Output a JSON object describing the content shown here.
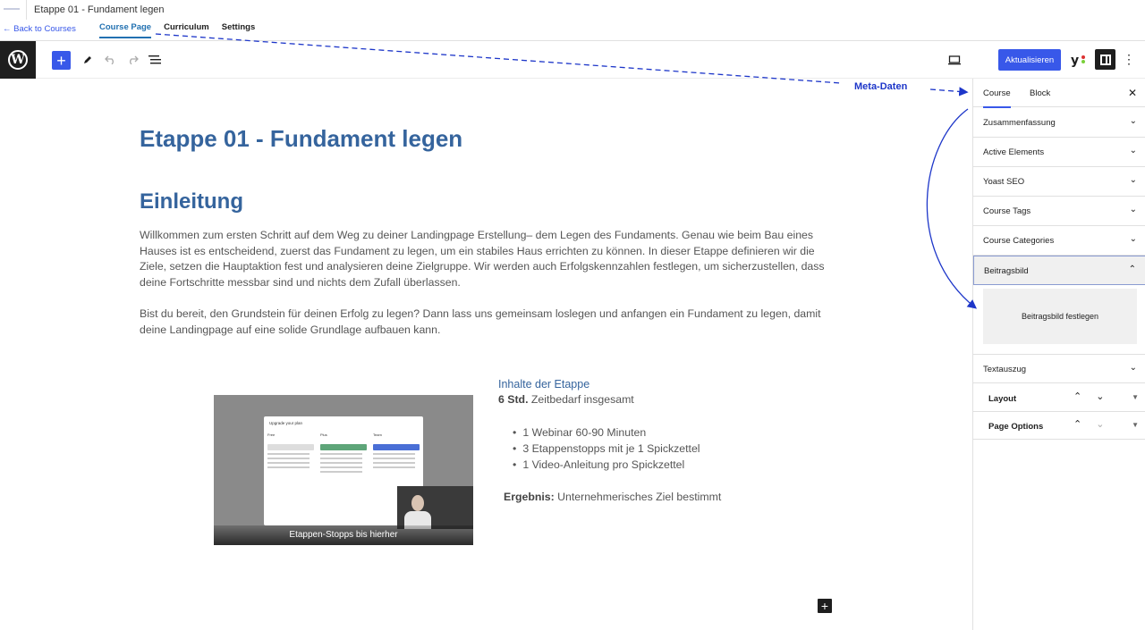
{
  "course_bar": {
    "post_title": "Etappe 01 - Fundament legen",
    "back_link": "← Back to Courses",
    "tabs": [
      {
        "label": "Course Page",
        "active": true
      },
      {
        "label": "Curriculum",
        "active": false
      },
      {
        "label": "Settings",
        "active": false
      }
    ]
  },
  "toolbar": {
    "update_label": "Aktualisieren",
    "icons": [
      "wordpress-logo",
      "add-block-icon",
      "pencil-icon",
      "undo-icon",
      "redo-icon",
      "list-view-icon",
      "desktop-preview-icon",
      "yoast-icon",
      "settings-icon",
      "more-options-icon"
    ]
  },
  "content": {
    "title": "Etappe 01 - Fundament legen",
    "heading": "Einleitung",
    "paragraph1": "Willkommen zum ersten Schritt auf dem Weg zu deiner Landingpage Erstellung– dem Legen des Fundaments. Genau wie beim Bau eines Hauses ist es entscheidend, zuerst das Fundament zu legen, um ein stabiles Haus errichten zu können. In dieser Etappe definieren wir die Ziele, setzen die Hauptaktion fest und analysieren deine Zielgruppe. Wir werden auch Erfolgskennzahlen festlegen, um sicherzustellen, dass deine Fortschritte messbar sind und nichts dem Zufall überlassen.",
    "paragraph2": "Bist du bereit, den Grundstein für deinen Erfolg zu legen? Dann lass uns gemeinsam loslegen und anfangen ein Fundament zu legen, damit deine Landingpage auf eine solide Grundlage aufbauen kann.",
    "video_caption": "Etappen-Stopps bis hierher",
    "video_modal": {
      "title": "Upgrade your plan",
      "columns": [
        "Free",
        "Plus",
        "Team"
      ]
    },
    "side_heading": "Inhalte der Etappe",
    "time_bold": "6 Std.",
    "time_text": " Zeitbedarf insgesamt",
    "list": [
      "1 Webinar 60-90 Minuten",
      "3 Etappenstopps mit je 1 Spickzettel",
      "1 Video-Anleitung pro Spickzettel"
    ],
    "result_bold": "Ergebnis:",
    "result_text": " Unternehmerisches Ziel bestimmt"
  },
  "sidebar": {
    "tabs": [
      "Course",
      "Block"
    ],
    "panels": [
      "Zusammenfassung",
      "Active Elements",
      "Yoast SEO",
      "Course Tags",
      "Course Categories",
      "Beitragsbild"
    ],
    "featured_button": "Beitragsbild festlegen",
    "excerpt_panel": "Textauszug",
    "meta_boxes": [
      "Layout",
      "Page Options"
    ]
  },
  "annotation": {
    "label": "Meta-Daten",
    "color": "#1d36c9"
  }
}
